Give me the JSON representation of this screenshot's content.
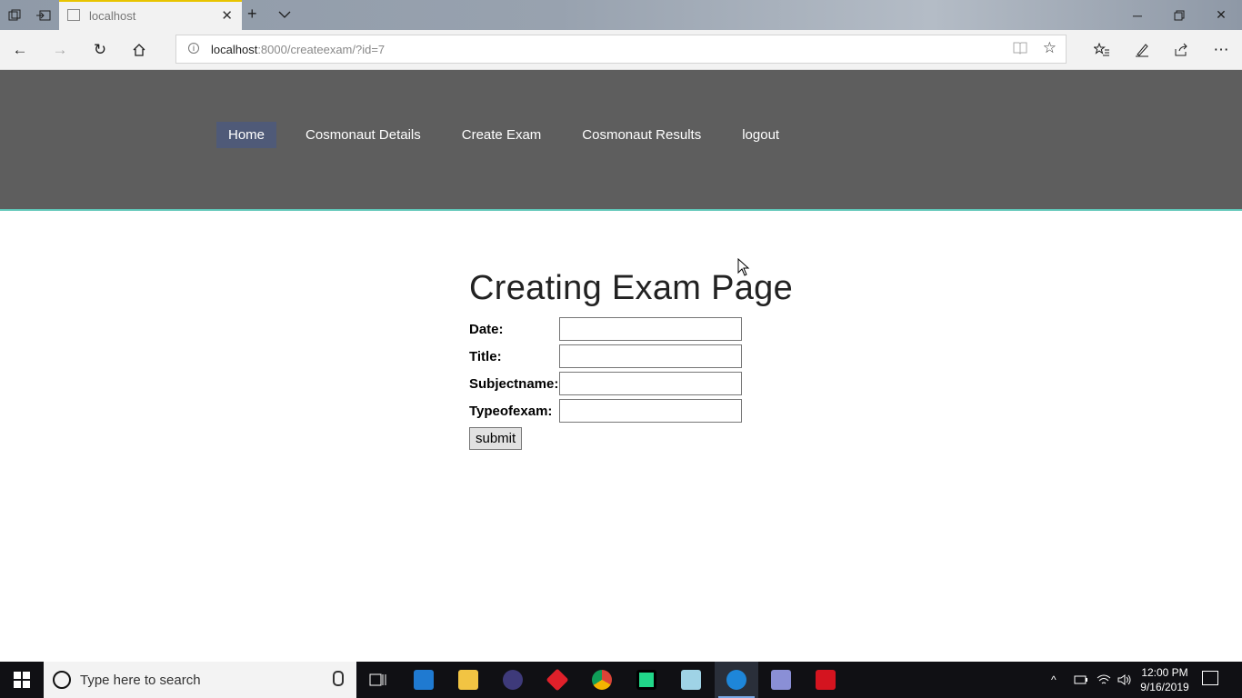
{
  "browser": {
    "tab_title": "localhost",
    "url_host": "localhost",
    "url_path": ":8000/createexam/?id=7"
  },
  "nav": {
    "items": [
      {
        "label": "Home",
        "active": true
      },
      {
        "label": "Cosmonaut Details"
      },
      {
        "label": "Create Exam"
      },
      {
        "label": "Cosmonaut Results"
      },
      {
        "label": "logout"
      }
    ]
  },
  "page": {
    "title": "Creating Exam Page",
    "fields": [
      {
        "label": "Date:",
        "value": ""
      },
      {
        "label": "Title:",
        "value": ""
      },
      {
        "label": "Subjectname:",
        "value": ""
      },
      {
        "label": "Typeofexam:",
        "value": ""
      }
    ],
    "submit_label": "submit"
  },
  "taskbar": {
    "search_placeholder": "Type here to search",
    "time": "12:00 PM",
    "date": "9/16/2019"
  },
  "colors": {
    "header_bg": "#5e5e5e",
    "nav_active": "#4f5a78",
    "header_accent": "#5fc7b8"
  }
}
